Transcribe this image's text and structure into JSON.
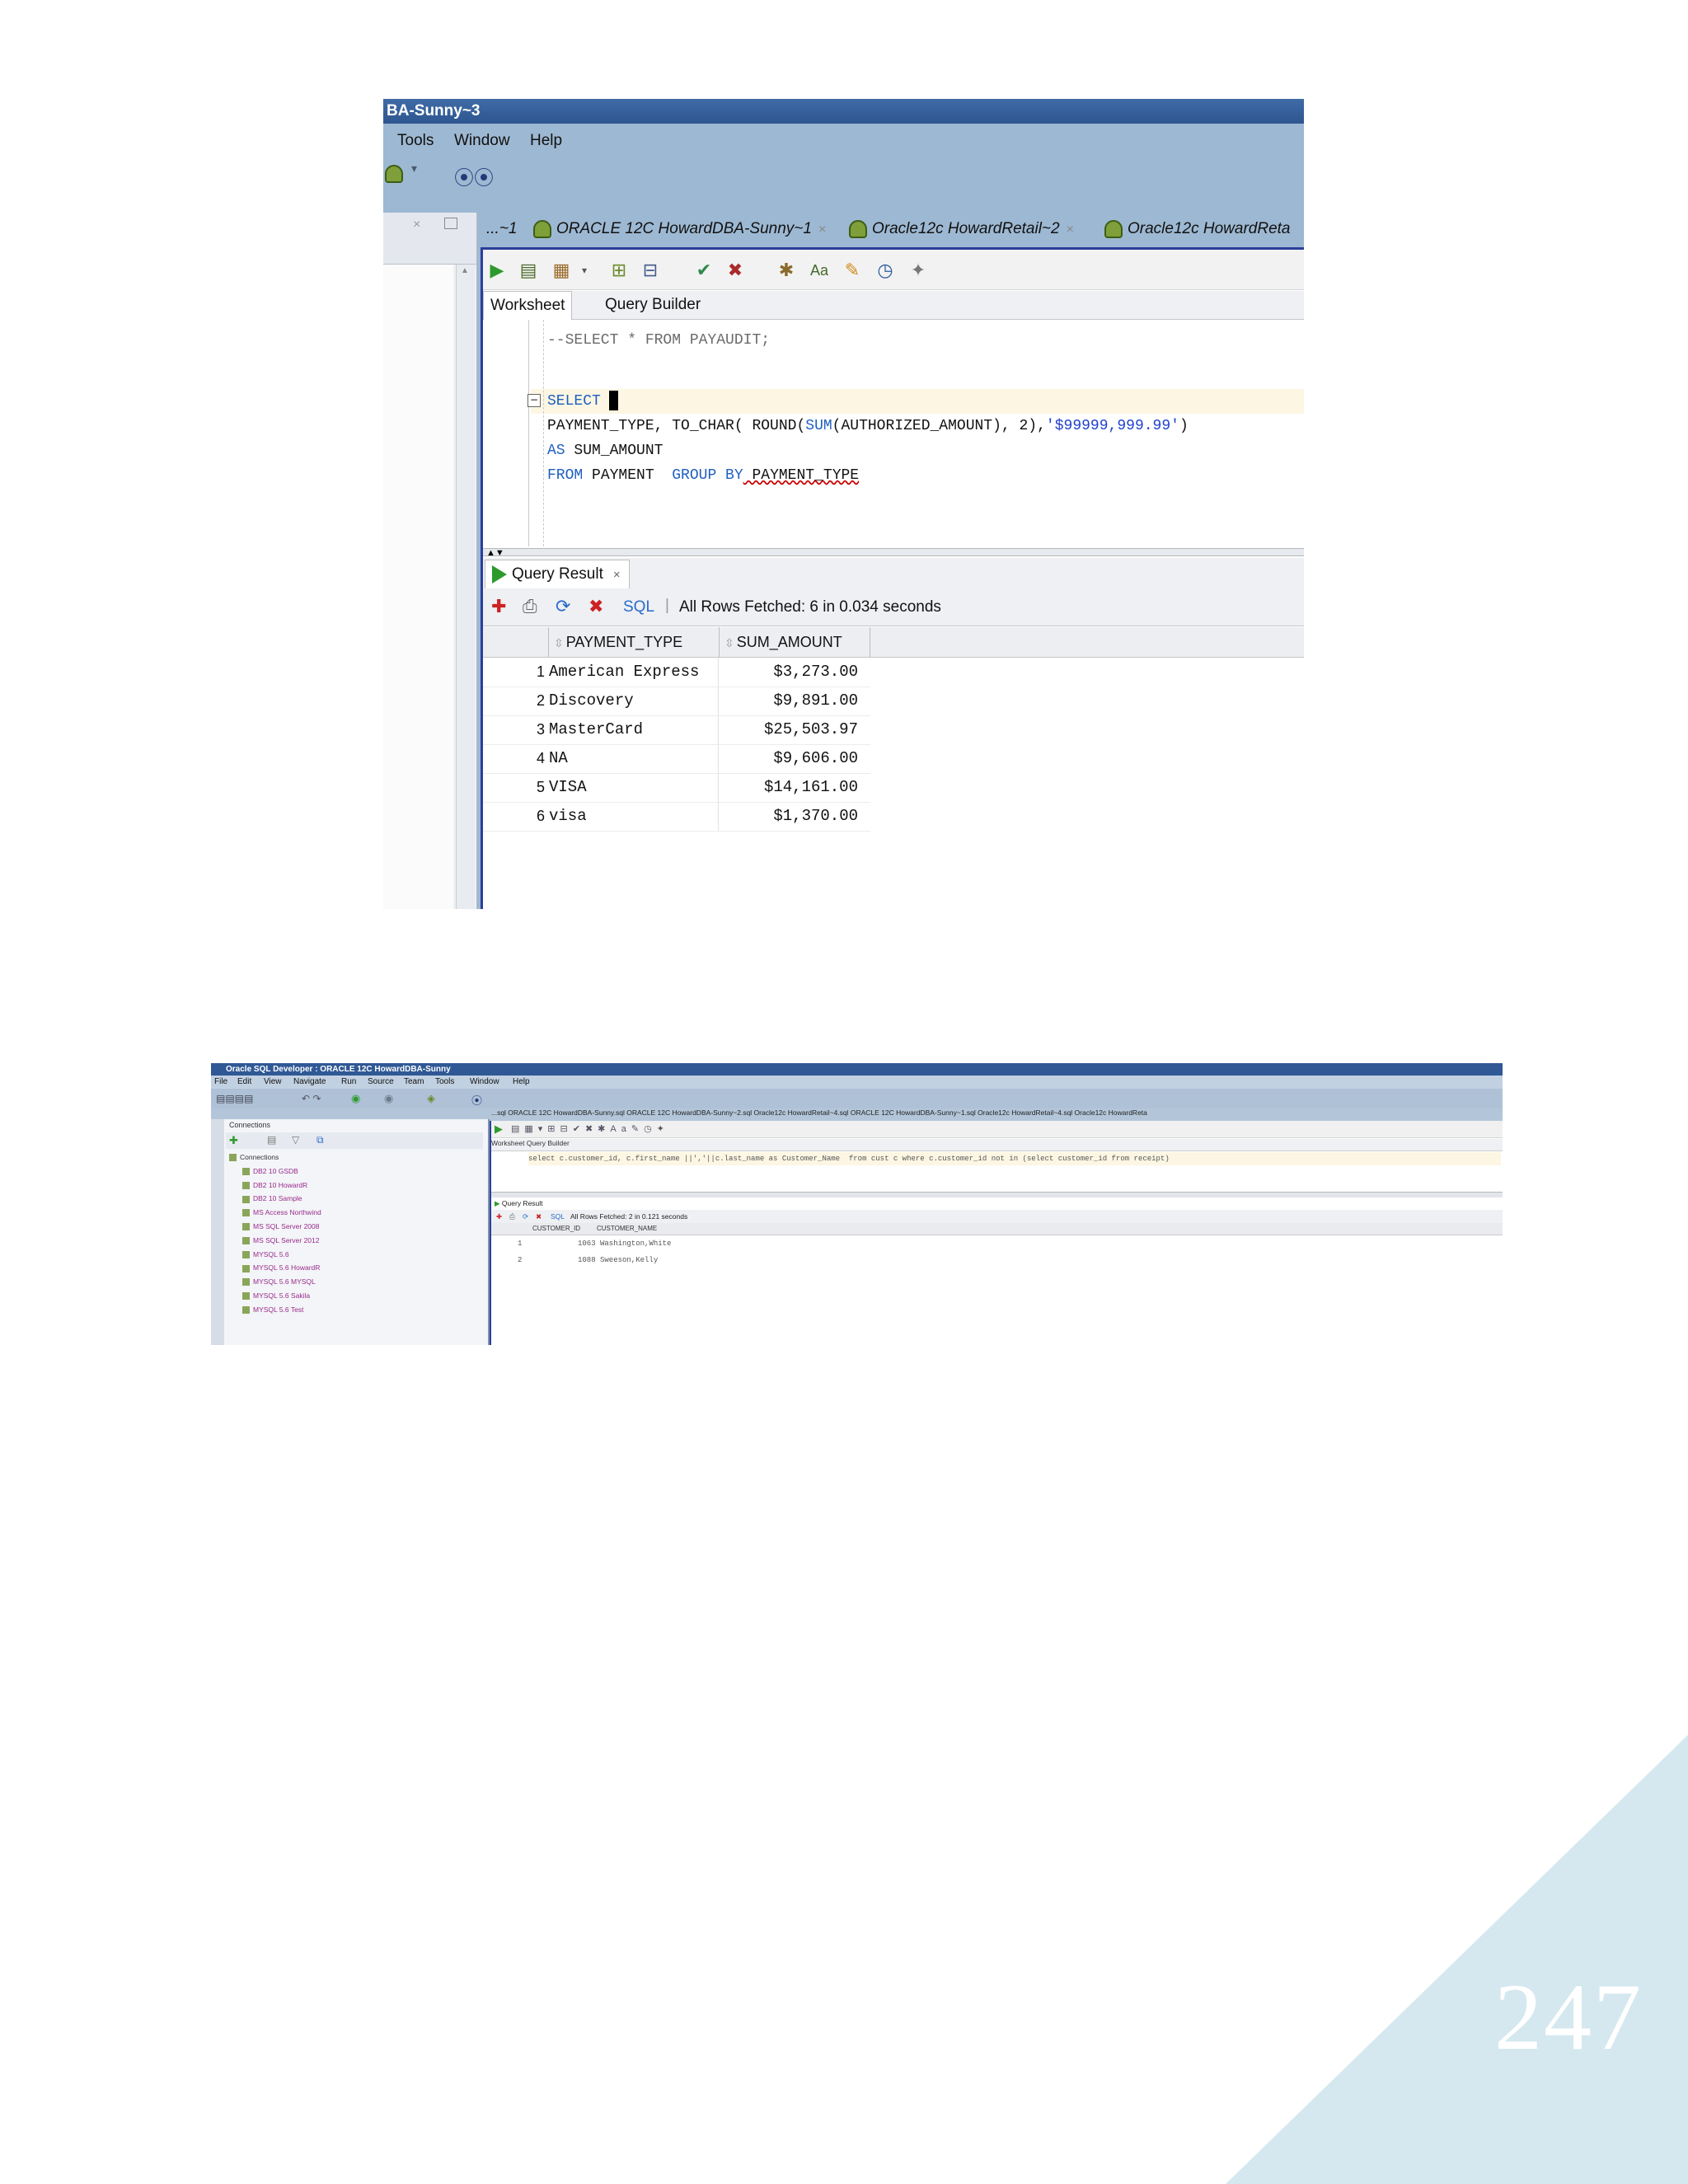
{
  "shot1": {
    "window_title": "BA-Sunny~3",
    "menu": [
      "Tools",
      "Window",
      "Help"
    ],
    "tabs": [
      {
        "label": "...~1"
      },
      {
        "label": "ORACLE 12C HowardDBA-Sunny~1"
      },
      {
        "label": "Oracle12c HowardRetail~2"
      },
      {
        "label": "Oracle12c HowardReta"
      }
    ],
    "subtabs": {
      "worksheet": "Worksheet",
      "query_builder": "Query Builder"
    },
    "code": {
      "line1": "--SELECT * FROM PAYAUDIT;",
      "line2_kw": "SELECT",
      "line3_a": "PAYMENT_TYPE, TO_CHAR( ROUND(",
      "line3_fn": "SUM",
      "line3_b": "(AUTHORIZED_AMOUNT), 2),",
      "line3_str": "'$99999,999.99'",
      "line3_c": ")",
      "line4_kw": "AS",
      "line4_rest": " SUM_AMOUNT",
      "line5_kw1": "FROM",
      "line5_mid": " PAYMENT  ",
      "line5_kw2": "GROUP BY",
      "line5_rest": " PAYMENT_TYPE"
    },
    "result": {
      "tab_label": "Query Result",
      "sql_link": "SQL",
      "status": "All Rows Fetched: 6 in 0.034 seconds",
      "columns": [
        "PAYMENT_TYPE",
        "SUM_AMOUNT"
      ],
      "rows": [
        {
          "n": "1",
          "type": "American Express",
          "amount": "$3,273.00"
        },
        {
          "n": "2",
          "type": "Discovery",
          "amount": "$9,891.00"
        },
        {
          "n": "3",
          "type": "MasterCard",
          "amount": "$25,503.97"
        },
        {
          "n": "4",
          "type": "NA",
          "amount": "$9,606.00"
        },
        {
          "n": "5",
          "type": "VISA",
          "amount": "$14,161.00"
        },
        {
          "n": "6",
          "type": "visa",
          "amount": "$1,370.00"
        }
      ]
    }
  },
  "shot2": {
    "window_title": "Oracle SQL Developer : ORACLE 12C HowardDBA-Sunny",
    "menu": [
      "File",
      "Edit",
      "View",
      "Navigate",
      "Run",
      "Source",
      "Team",
      "Tools",
      "Window",
      "Help"
    ],
    "connections_title": "Connections",
    "tree": [
      {
        "label": "Connections",
        "child": false
      },
      {
        "label": "DB2 10 GSDB",
        "child": true
      },
      {
        "label": "DB2 10 HowardR",
        "child": true
      },
      {
        "label": "DB2 10 Sample",
        "child": true
      },
      {
        "label": "MS Access Northwind",
        "child": true
      },
      {
        "label": "MS SQL Server 2008",
        "child": true
      },
      {
        "label": "MS SQL Server 2012",
        "child": true
      },
      {
        "label": "MYSQL 5.6",
        "child": true
      },
      {
        "label": "MYSQL 5.6 HowardR",
        "child": true
      },
      {
        "label": "MYSQL 5.6 MYSQL",
        "child": true
      },
      {
        "label": "MYSQL 5.6 Sakila",
        "child": true
      },
      {
        "label": "MYSQL 5.6 Test",
        "child": true
      }
    ],
    "tabs_text": "...sql   ORACLE 12C HowardDBA-Sunny.sql   ORACLE 12C HowardDBA-Sunny~2.sql   Oracle12c HowardRetail~4.sql   ORACLE 12C HowardDBA-Sunny~1.sql   Oracle12c HowardRetail~4.sql   Oracle12c HowardReta",
    "subtabs": "Worksheet    Query Builder",
    "code": "select c.customer_id, c.first_name ||','||c.last_name as Customer_Name  from cust c where c.customer_id not in (select customer_id from receipt)",
    "result_tab": "Query Result",
    "status": "All Rows Fetched: 2 in 0.121 seconds",
    "sql_link": "SQL",
    "columns": [
      "CUSTOMER_ID",
      "CUSTOMER_NAME"
    ],
    "rows": [
      {
        "n": "1",
        "text": "1063 Washington,White"
      },
      {
        "n": "2",
        "text": "1088 Sweeson,Kelly"
      }
    ]
  },
  "page": {
    "number": "247",
    "corner_color": "#d5e8ef"
  }
}
